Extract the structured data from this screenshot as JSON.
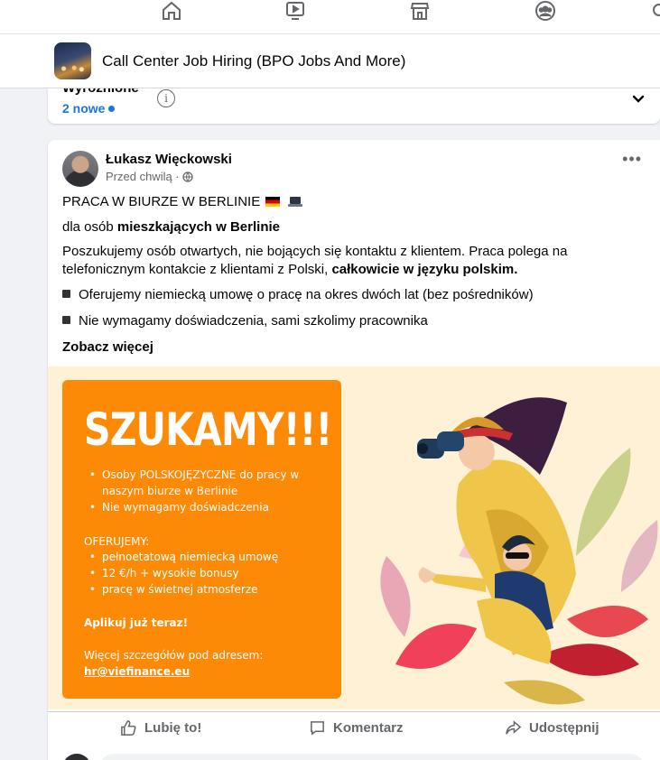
{
  "topnav": {
    "icons": [
      "home-icon",
      "watch-icon",
      "marketplace-icon",
      "groups-icon"
    ]
  },
  "group": {
    "title": "Call Center Job Hiring (BPO Jobs And More)"
  },
  "featured": {
    "label": "Wyróżnione",
    "new_label": "2 nowe",
    "info_glyph": "i"
  },
  "post": {
    "author": "Łukasz Więckowski",
    "time": "Przed chwilą ·",
    "line1": "PRACA W BIURZE W BERLINIE",
    "line2_prefix": "dla osób ",
    "line2_bold": "mieszkających w Berlinie",
    "para1": "Poszukujemy osób otwartych, nie bojących się kontaktu z klientem. Praca polega na telefonicznym kontakcie z klientami z Polski, ",
    "para1_bold": "całkowicie w języku polskim.",
    "bullets": [
      "Oferujemy niemiecką umowę o pracę na okres dwóch lat (bez pośredników)",
      "Nie wymagamy doświadczenia, sami szkolimy pracownika"
    ],
    "see_more": "Zobacz więcej"
  },
  "ad_image": {
    "headline": "SZUKAMY!!!",
    "list1": [
      "Osoby POLSKOJĘZYCZNE do pracy w naszym biurze w Berlinie",
      "Nie wymagamy doświadczenia"
    ],
    "offer_label": "OFERUJEMY:",
    "list2": [
      "pełnoetatową niemiecką umowę",
      "12 €/h + wysokie bonusy",
      "pracę w świetnej atmosferze"
    ],
    "apply": "Aplikuj już teraz!",
    "details": "Więcej szczegółów pod adresem:",
    "email": "hr@viefinance.eu"
  },
  "actions": {
    "like": "Lubię to!",
    "comment": "Komentarz",
    "share": "Udostępnij"
  },
  "colors": {
    "accent": "#1b74e4",
    "orange": "#fd8a06",
    "cream": "#fef1d6"
  }
}
